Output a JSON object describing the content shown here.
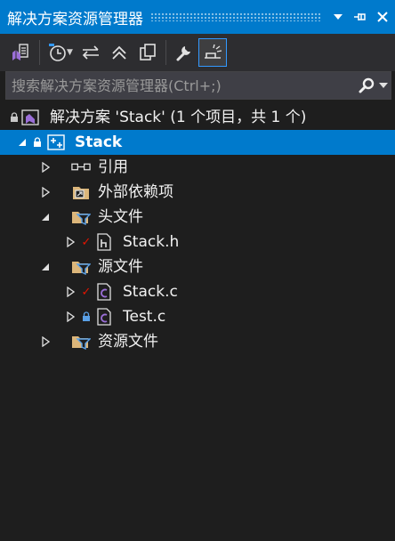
{
  "window": {
    "title": "解决方案资源管理器",
    "controls": {
      "dropdown": "▾",
      "pin": "⊸",
      "close": "✕"
    }
  },
  "toolbar": {
    "buttons": [
      {
        "name": "vs-solution-button",
        "icon": "vs-solution-icon"
      },
      {
        "name": "pending-changes-button",
        "icon": "clock-icon"
      },
      {
        "name": "sync-active-doc-button",
        "icon": "sync-arrows-icon"
      },
      {
        "name": "collapse-all-button",
        "icon": "collapse-all-icon"
      },
      {
        "name": "show-all-files-button",
        "icon": "copy-files-icon"
      },
      {
        "name": "properties-button",
        "icon": "wrench-icon"
      },
      {
        "name": "preview-selected-button",
        "icon": "preview-icon",
        "active": true
      }
    ]
  },
  "search": {
    "placeholder": "搜索解决方案资源管理器(Ctrl+;)",
    "value": ""
  },
  "tree": {
    "solution": {
      "label": "解决方案 'Stack' (1 个项目，共 1 个)"
    },
    "project": {
      "label": "Stack"
    },
    "items": [
      {
        "key": "references",
        "label": "引用",
        "expander": "collapsed"
      },
      {
        "key": "external",
        "label": "外部依赖项",
        "expander": "collapsed"
      },
      {
        "key": "header-folder",
        "label": "头文件",
        "expander": "expanded"
      },
      {
        "key": "stack-h",
        "label": "Stack.h",
        "expander": "collapsed",
        "state": "checked-out"
      },
      {
        "key": "source-folder",
        "label": "源文件",
        "expander": "expanded"
      },
      {
        "key": "stack-c",
        "label": "Stack.c",
        "expander": "collapsed",
        "state": "checked-out"
      },
      {
        "key": "test-c",
        "label": "Test.c",
        "expander": "collapsed",
        "state": "locked"
      },
      {
        "key": "resource-folder",
        "label": "资源文件",
        "expander": "collapsed"
      }
    ],
    "glyphs": {
      "check": "✓",
      "lock": "🔒"
    }
  },
  "colors": {
    "accent": "#007acc",
    "background": "#1e1e1e",
    "toolbar": "#2d2d30",
    "search_bg": "#3f3f46",
    "text": "#f1f1f1",
    "folder": "#dcb67a",
    "vs_purple": "#9b6fd8",
    "checkmark": "#e51400"
  }
}
